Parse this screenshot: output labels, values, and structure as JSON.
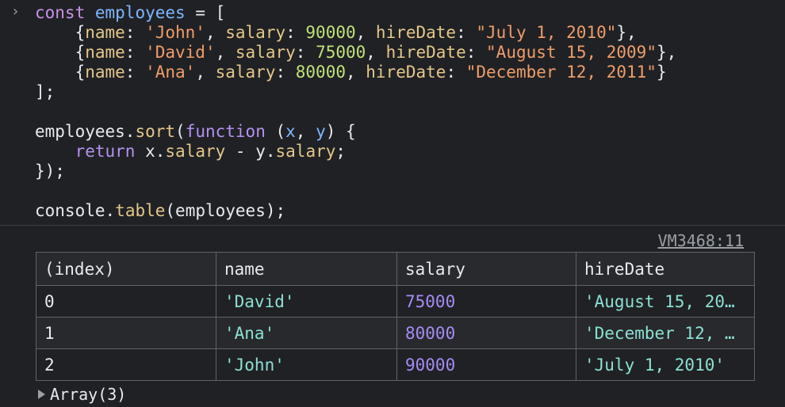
{
  "console": {
    "prompt_symbol": "›",
    "code": {
      "l1": {
        "kw": "const",
        "name": "employees",
        "eq": " = ",
        "open": "["
      },
      "emp1": {
        "name": "'John'",
        "salary": "90000",
        "hireDate": "\"July 1, 2010\""
      },
      "emp2": {
        "name": "'David'",
        "salary": "75000",
        "hireDate": "\"August 15, 2009\""
      },
      "emp3": {
        "name": "'Ana'",
        "salary": "80000",
        "hireDate": "\"December 12, 2011\""
      },
      "close": "];",
      "sort": {
        "obj": "employees",
        "method": "sort",
        "fn_kw": "function",
        "p1": "x",
        "p2": "y",
        "ret": "return",
        "a": "x",
        "b": "y",
        "prop": "salary",
        "end": "});"
      },
      "log": {
        "obj": "console",
        "method": "table",
        "arg": "employees",
        "end": ");"
      }
    },
    "source_link": "VM3468:11",
    "table": {
      "headers": [
        "(index)",
        "name",
        "salary",
        "hireDate"
      ],
      "rows": [
        {
          "index": "0",
          "name": "'David'",
          "salary": "75000",
          "hireDate": "'August 15, 20…"
        },
        {
          "index": "1",
          "name": "'Ana'",
          "salary": "80000",
          "hireDate": "'December 12, …"
        },
        {
          "index": "2",
          "name": "'John'",
          "salary": "90000",
          "hireDate": "'July 1, 2010'"
        }
      ]
    },
    "array_summary": "Array(3)"
  }
}
